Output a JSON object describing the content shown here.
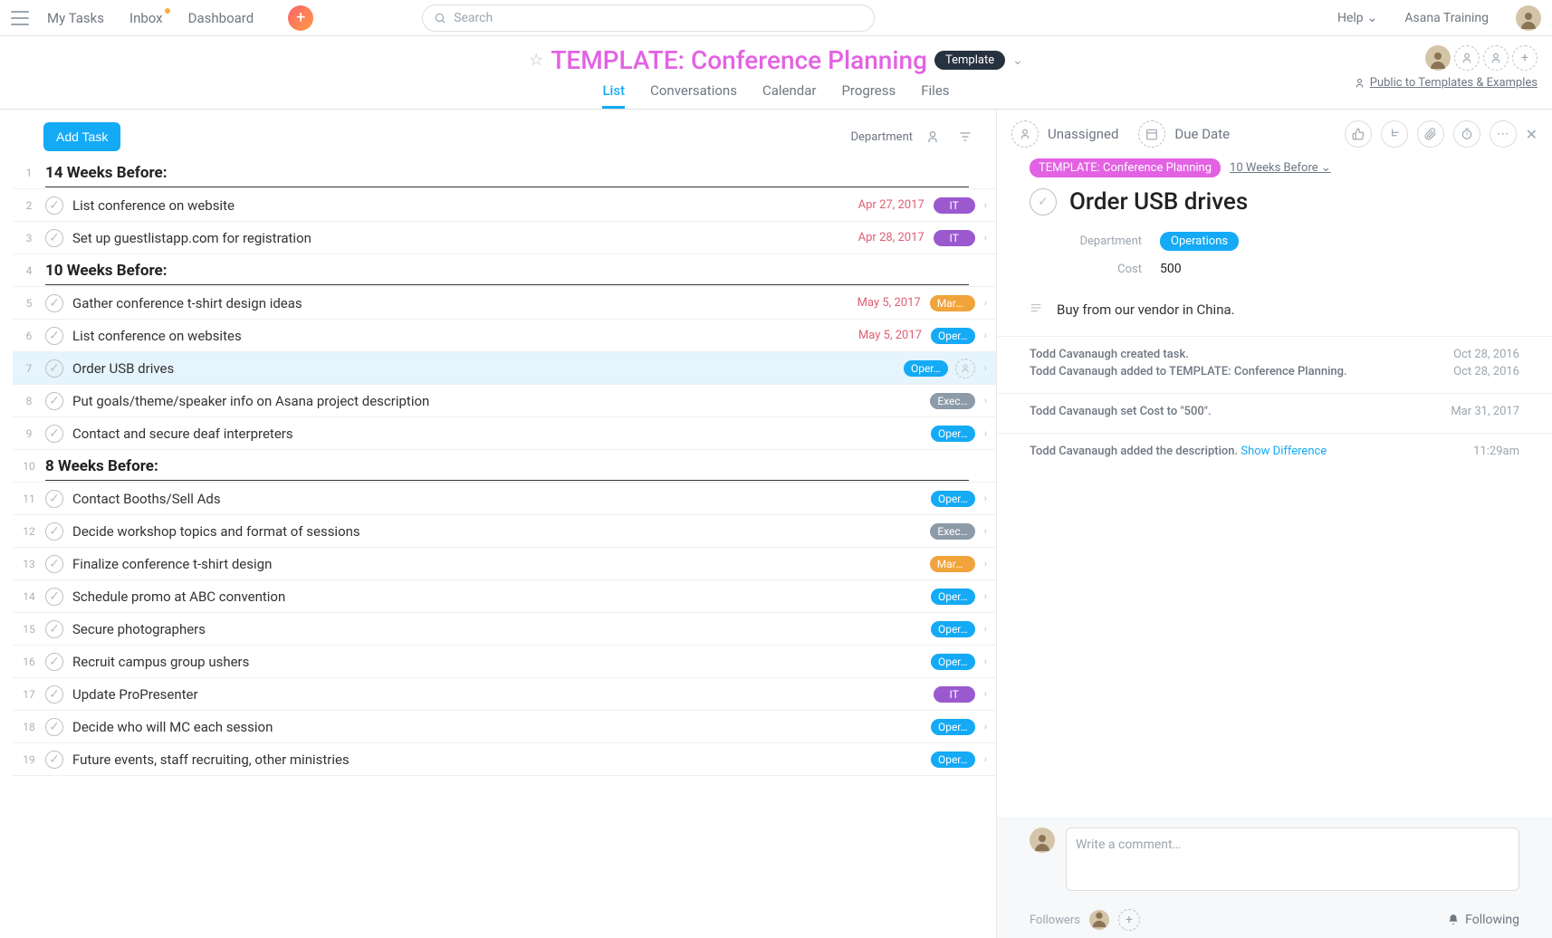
{
  "topbar": {
    "nav": {
      "my_tasks": "My Tasks",
      "inbox": "Inbox",
      "dashboard": "Dashboard"
    },
    "search_placeholder": "Search",
    "help": "Help",
    "workspace": "Asana Training"
  },
  "project": {
    "title": "TEMPLATE: Conference Planning",
    "template_badge": "Template",
    "tabs": {
      "list": "List",
      "conversations": "Conversations",
      "calendar": "Calendar",
      "progress": "Progress",
      "files": "Files"
    },
    "public_link": "Public to Templates & Examples"
  },
  "list_toolbar": {
    "add_task": "Add Task",
    "sort_label": "Department"
  },
  "tasks": {
    "s1": "14 Weeks Before:",
    "r2": {
      "name": "List conference on website",
      "date": "Apr 27, 2017",
      "tag": "IT"
    },
    "r3": {
      "name": "Set up guestlistapp.com for registration",
      "date": "Apr 28, 2017",
      "tag": "IT"
    },
    "s4": "10 Weeks Before:",
    "r5": {
      "name": "Gather conference t-shirt design ideas",
      "date": "May 5, 2017",
      "tag": "Mark…"
    },
    "r6": {
      "name": "List conference on websites",
      "date": "May 5, 2017",
      "tag": "Oper…"
    },
    "r7": {
      "name": "Order USB drives",
      "tag": "Oper…"
    },
    "r8": {
      "name": "Put goals/theme/speaker info on Asana project description",
      "tag": "Exec…"
    },
    "r9": {
      "name": "Contact and secure deaf interpreters",
      "tag": "Oper…"
    },
    "s10": "8 Weeks Before:",
    "r11": {
      "name": "Contact Booths/Sell Ads",
      "tag": "Oper…"
    },
    "r12": {
      "name": "Decide workshop topics and format of sessions",
      "tag": "Exec…"
    },
    "r13": {
      "name": "Finalize conference t-shirt design",
      "tag": "Mark…"
    },
    "r14": {
      "name": "Schedule promo at ABC convention",
      "tag": "Oper…"
    },
    "r15": {
      "name": "Secure photographers",
      "tag": "Oper…"
    },
    "r16": {
      "name": "Recruit campus group ushers",
      "tag": "Oper…"
    },
    "r17": {
      "name": "Update ProPresenter",
      "tag": "IT"
    },
    "r18": {
      "name": "Decide who will MC each session",
      "tag": "Oper…"
    },
    "r19": {
      "name": "Future events, staff recruiting, other ministries",
      "tag": "Oper…"
    }
  },
  "details": {
    "unassigned": "Unassigned",
    "due_date": "Due Date",
    "project_pill": "TEMPLATE: Conference Planning",
    "section": "10 Weeks Before",
    "title": "Order USB drives",
    "fields": {
      "department_label": "Department",
      "department_value": "Operations",
      "cost_label": "Cost",
      "cost_value": "500"
    },
    "description": "Buy from our vendor in China.",
    "activity": {
      "a1": {
        "text": "Todd Cavanaugh created task.",
        "date": "Oct 28, 2016"
      },
      "a2": {
        "text": "Todd Cavanaugh added to TEMPLATE: Conference Planning.",
        "date": "Oct 28, 2016"
      },
      "a3": {
        "text": "Todd Cavanaugh set Cost to \"500\".",
        "date": "Mar 31, 2017"
      },
      "a4": {
        "text": "Todd Cavanaugh added the description.",
        "link": "Show Difference",
        "date": "11:29am"
      }
    },
    "comment_placeholder": "Write a comment…",
    "followers_label": "Followers",
    "following": "Following"
  }
}
